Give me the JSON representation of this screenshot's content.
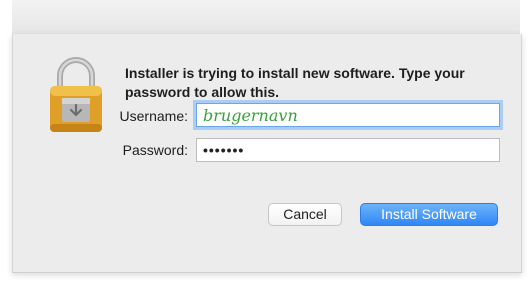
{
  "dialog": {
    "message": "Installer is trying to install new software. Type your password to allow this.",
    "username_label": "Username:",
    "username_value": "brugernavn",
    "password_label": "Password:",
    "password_value": "•••••••",
    "cancel_label": "Cancel",
    "install_label": "Install Software",
    "icon": "padlock-installer-icon"
  },
  "colors": {
    "accent": "#2f87f6",
    "focus_ring": "#a9cdf4",
    "sheet_bg": "#ececec"
  }
}
